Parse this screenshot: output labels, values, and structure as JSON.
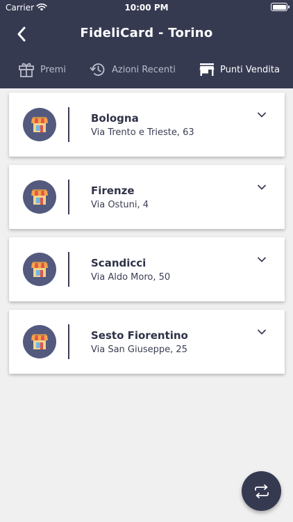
{
  "status_bar": {
    "carrier": "Carrier",
    "time": "10:00 PM"
  },
  "header": {
    "title": "FideliCard - Torino"
  },
  "tabs": [
    {
      "label": "Premi",
      "icon": "gift-icon",
      "active": false
    },
    {
      "label": "Azioni Recenti",
      "icon": "history-icon",
      "active": false
    },
    {
      "label": "Punti Vendita",
      "icon": "store-icon",
      "active": true
    }
  ],
  "stores": [
    {
      "name": "Bologna",
      "address": "Via Trento e Trieste, 63"
    },
    {
      "name": "Firenze",
      "address": "Via Ostuni, 4"
    },
    {
      "name": "Scandicci",
      "address": "Via Aldo Moro, 50"
    },
    {
      "name": "Sesto Fiorentino",
      "address": "Via San Giuseppe, 25"
    }
  ],
  "colors": {
    "header_bg": "#363a51",
    "avatar_bg": "#535a7e",
    "page_bg": "#f0f0f1",
    "awning_orange": "#f5a54a",
    "awning_red": "#e2544b"
  },
  "fab": {
    "icon": "swap-icon"
  }
}
